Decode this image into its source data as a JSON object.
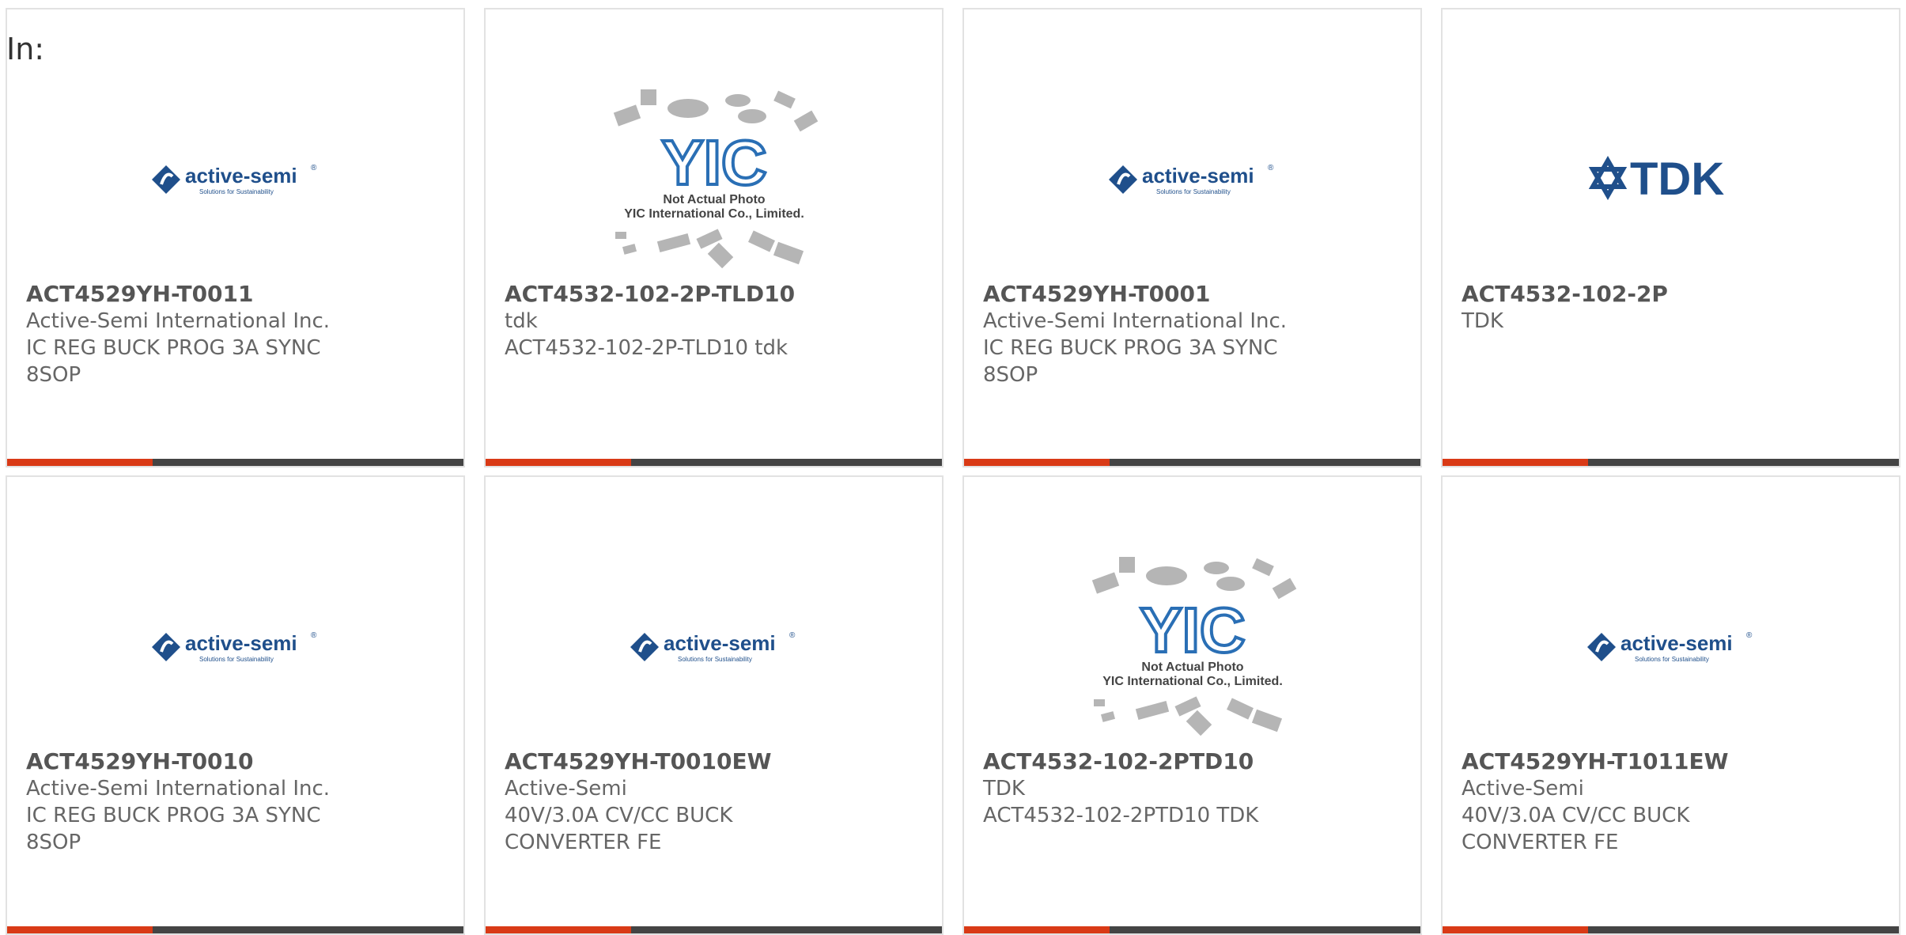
{
  "filter_label": "In:",
  "colors": {
    "accent": "#d93a16",
    "bar": "#444444",
    "brand_blue": "#1f4f8b"
  },
  "logo_text": {
    "active_semi": "active-semi",
    "active_semi_tagline": "Solutions for Sustainability",
    "tdk": "TDK",
    "yic": "YIC",
    "yic_line1": "Not Actual Photo",
    "yic_line2": "YIC International Co., Limited."
  },
  "products": [
    {
      "part_number": "ACT4529YH-T0011",
      "manufacturer": "Active-Semi International Inc.",
      "description": "IC REG BUCK PROG 3A SYNC 8SOP",
      "image": "active-semi-logo"
    },
    {
      "part_number": "ACT4532-102-2P-TLD10",
      "manufacturer": "tdk",
      "description": "ACT4532-102-2P-TLD10 tdk",
      "image": "yic-placeholder"
    },
    {
      "part_number": "ACT4529YH-T0001",
      "manufacturer": "Active-Semi International Inc.",
      "description": "IC REG BUCK PROG 3A SYNC 8SOP",
      "image": "active-semi-logo"
    },
    {
      "part_number": "ACT4532-102-2P",
      "manufacturer": "TDK",
      "description": "",
      "image": "tdk-logo"
    },
    {
      "part_number": "ACT4529YH-T0010",
      "manufacturer": "Active-Semi International Inc.",
      "description": "IC REG BUCK PROG 3A SYNC 8SOP",
      "image": "active-semi-logo"
    },
    {
      "part_number": "ACT4529YH-T0010EW",
      "manufacturer": "Active-Semi",
      "description": "40V/3.0A CV/CC BUCK CONVERTER FE",
      "image": "active-semi-logo"
    },
    {
      "part_number": "ACT4532-102-2PTD10",
      "manufacturer": "TDK",
      "description": "ACT4532-102-2PTD10 TDK",
      "image": "yic-placeholder"
    },
    {
      "part_number": "ACT4529YH-T1011EW",
      "manufacturer": "Active-Semi",
      "description": "40V/3.0A CV/CC BUCK CONVERTER FE",
      "image": "active-semi-logo"
    }
  ]
}
